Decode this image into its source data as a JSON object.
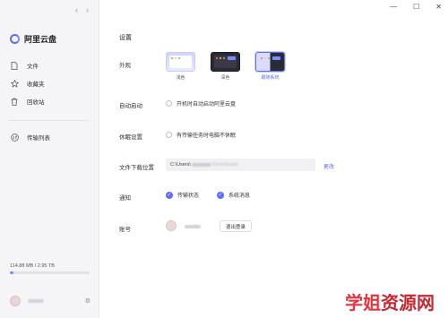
{
  "sidebar": {
    "back_arrow": "‹",
    "forward_arrow": "›",
    "app_name": "阿里云盘",
    "items": [
      {
        "label": "文件",
        "icon": "file-icon"
      },
      {
        "label": "收藏夹",
        "icon": "star-icon"
      },
      {
        "label": "回收站",
        "icon": "trash-icon"
      },
      {
        "label": "传输列表",
        "icon": "transfer-icon"
      }
    ],
    "storage": {
      "text": "114.88 MB / 2.95 TB",
      "used_fraction": 0.04
    }
  },
  "window_controls": {
    "minimize": "—",
    "maximize": "☐",
    "close": "✕"
  },
  "settings": {
    "title": "设置",
    "appearance": {
      "label": "外观",
      "themes": [
        {
          "label": "浅色"
        },
        {
          "label": "深色"
        },
        {
          "label": "跟随系统",
          "selected": true
        }
      ]
    },
    "autostart": {
      "label": "自动启动",
      "option": "开机时自动启动阿里云盘"
    },
    "sleep": {
      "label": "休眠设置",
      "option": "有传输任务时电脑不休眠"
    },
    "download_path": {
      "label": "文件下载位置",
      "prefix": "C:\\Users\\",
      "suffix": "\\Downloads",
      "change_label": "更改"
    },
    "notify": {
      "label": "通知",
      "options": [
        "传输状态",
        "系统消息"
      ]
    },
    "account": {
      "label": "账号",
      "logout_label": "退出登录"
    }
  },
  "watermark": {
    "part1": "学姐",
    "part2": "资源网"
  },
  "colors": {
    "accent": "#5b6cff",
    "sidebar_bg": "#f5f5f7"
  }
}
